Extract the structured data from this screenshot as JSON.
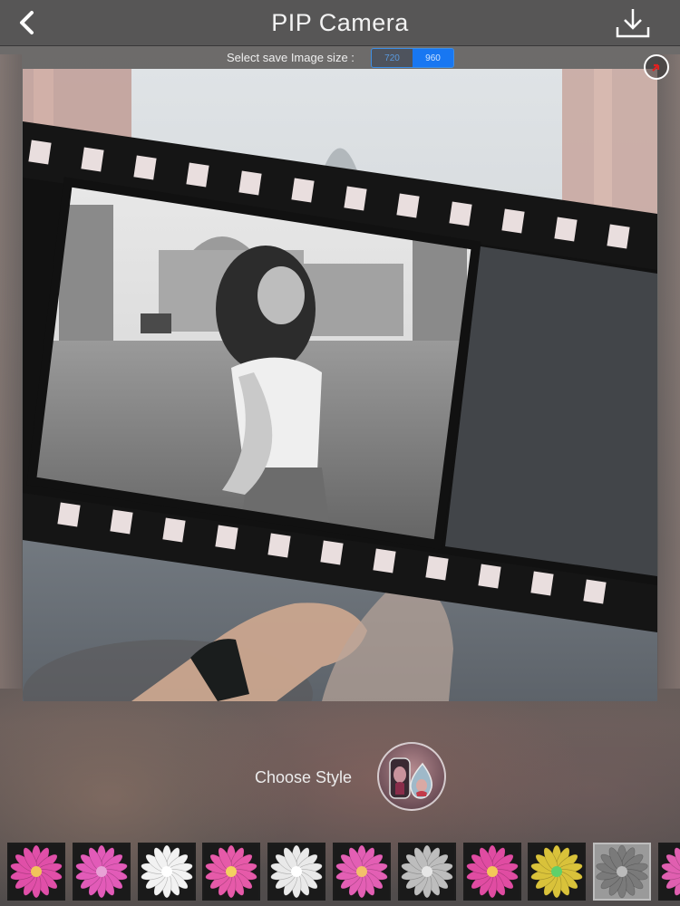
{
  "header": {
    "title": "PIP Camera",
    "back_icon": "chevron-left-icon",
    "download_icon": "download-icon"
  },
  "save_size": {
    "label": "Select save Image size :",
    "options": [
      "720",
      "960"
    ],
    "selected_index": 1
  },
  "canvas": {
    "info_icon": "info-icon"
  },
  "style_picker": {
    "label": "Choose Style"
  },
  "frames": [
    {
      "color": "#e04fa8",
      "center": "#f1c45a"
    },
    {
      "color": "#e25bb8",
      "center": "#e8a2d6"
    },
    {
      "color": "#f2f2f2",
      "center": "#ffffff"
    },
    {
      "color": "#e65aa9",
      "center": "#f4d060"
    },
    {
      "color": "#e9e9e9",
      "center": "#ffffff"
    },
    {
      "color": "#e35fb4",
      "center": "#f3c06a"
    },
    {
      "color": "#bdbdbd",
      "center": "#e6e6e6"
    },
    {
      "color": "#e04ca2",
      "center": "#f3c858"
    },
    {
      "color": "#d9c23a",
      "center": "#5fd06a"
    },
    {
      "color": "#7a7a7a",
      "center": "#bbbbbb"
    },
    {
      "color": "#e05fb0",
      "center": "#f2c05a"
    }
  ],
  "colors": {
    "accent": "#1877f2",
    "toggle_border": "#3d8fe6"
  }
}
